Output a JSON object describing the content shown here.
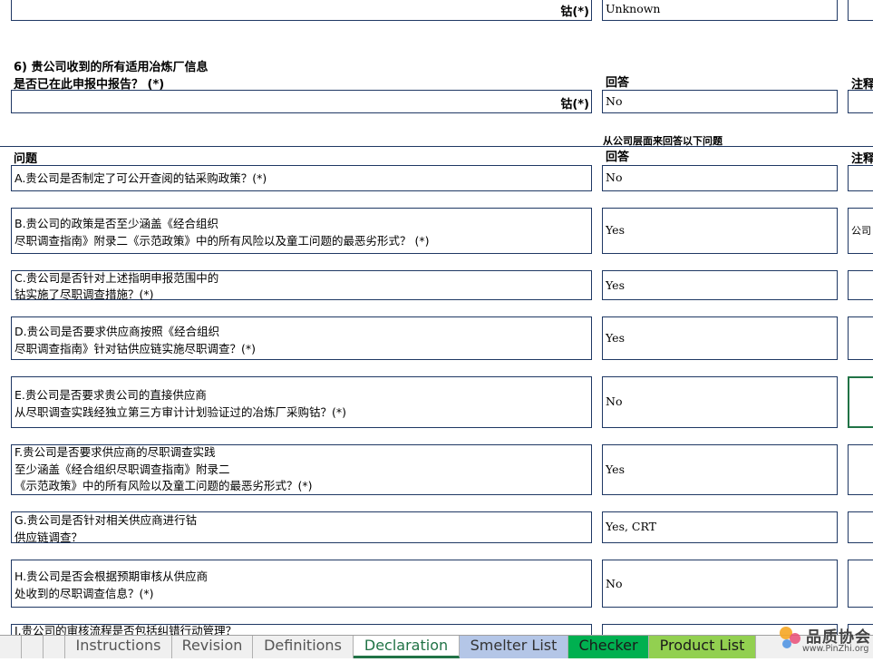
{
  "top_row": {
    "label": "钴(*)",
    "answer": "Unknown"
  },
  "q6": {
    "title_line1": "6) 贵公司收到的所有适用冶炼厂信息",
    "title_line2": "是否已在此申报中报告？ (*)",
    "answer_header": "回答",
    "comment_header": "注释",
    "label": "钴(*)",
    "answer": "No"
  },
  "company_section": {
    "note": "从公司层面来回答以下问题",
    "question_header": "问题",
    "answer_header": "回答",
    "comment_header": "注释"
  },
  "questions": [
    {
      "text": "A.贵公司是否制定了可公开查阅的钴采购政策？(*)",
      "answer": "No",
      "comment": ""
    },
    {
      "text": "B.贵公司的政策是否至少涵盖《经合组织\n尽职调查指南》附录二《示范政策》中的所有风险以及童工问题的最恶劣形式？ (*)",
      "answer": "Yes",
      "comment": "公司"
    },
    {
      "text": "C.贵公司是否针对上述指明申报范围中的\n钴实施了尽职调查措施？(*)",
      "answer": "Yes",
      "comment": ""
    },
    {
      "text": "D.贵公司是否要求供应商按照《经合组织\n尽职调查指南》针对钴供应链实施尽职调查？(*)",
      "answer": "Yes",
      "comment": ""
    },
    {
      "text": "E.贵公司是否要求贵公司的直接供应商\n从尽职调查实践经独立第三方审计计划验证过的冶炼厂采购钴？(*)",
      "answer": "No",
      "comment": ""
    },
    {
      "text": "F.贵公司是否要求供应商的尽职调查实践\n至少涵盖《经合组织尽职调查指南》附录二\n《示范政策》中的所有风险以及童工问题的最恶劣形式？(*)",
      "answer": "Yes",
      "comment": ""
    },
    {
      "text": "G.贵公司是否针对相关供应商进行钴\n供应链调查？",
      "answer": "Yes, CRT",
      "comment": ""
    },
    {
      "text": "H.贵公司是否会根据预期审核从供应商\n处收到的尽职调查信息？(*)",
      "answer": "No",
      "comment": ""
    },
    {
      "text": "I.贵公司的审核流程是否包括纠错行动管理？",
      "answer": "",
      "comment": ""
    }
  ],
  "tabs": [
    {
      "label": "Instructions",
      "color": "#f0f0f0",
      "text_color": "#555555"
    },
    {
      "label": "Revision",
      "color": "#f0f0f0",
      "text_color": "#555555"
    },
    {
      "label": "Definitions",
      "color": "#f0f0f0",
      "text_color": "#555555"
    },
    {
      "label": "Declaration",
      "color": "#ffffff",
      "text_color": "#217346"
    },
    {
      "label": "Smelter List",
      "color": "#b4c6e7",
      "text_color": "#333333"
    },
    {
      "label": "Checker",
      "color": "#00b050",
      "text_color": "#1a1a1a"
    },
    {
      "label": "Product List",
      "color": "#92d050",
      "text_color": "#1a1a1a"
    }
  ],
  "logo": {
    "text": "品质协会",
    "url_text": "www.PinZhi.org"
  }
}
